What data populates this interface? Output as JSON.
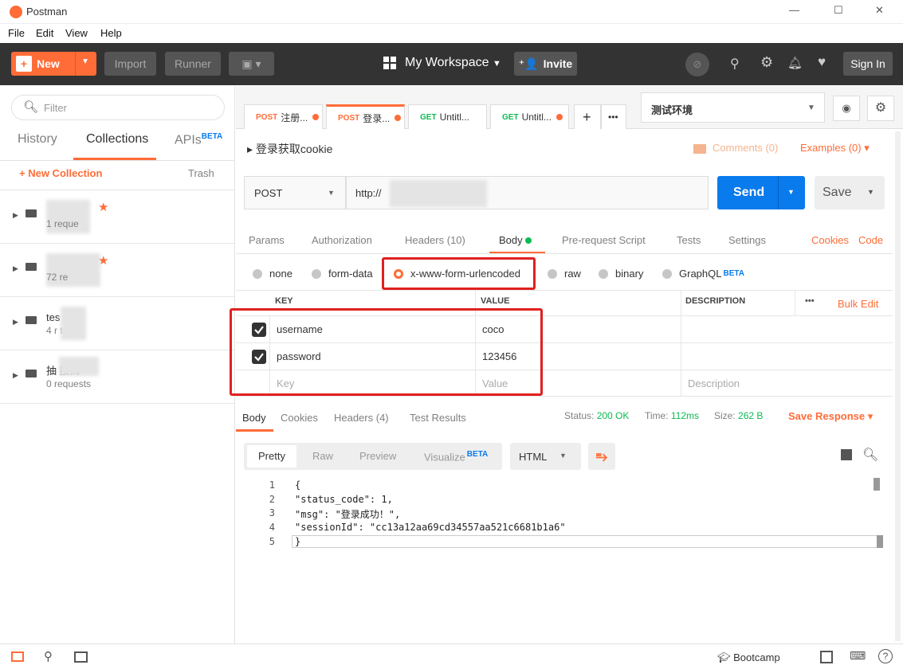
{
  "window": {
    "title": "Postman",
    "min": "—",
    "max": "☐",
    "close": "✕"
  },
  "menu": [
    "File",
    "Edit",
    "View",
    "Help"
  ],
  "header": {
    "new": "New",
    "import": "Import",
    "runner": "Runner",
    "workspace": "My Workspace",
    "invite": "Invite",
    "signin": "Sign In"
  },
  "sidebar": {
    "filter_placeholder": "Filter",
    "tabs": {
      "history": "History",
      "collections": "Collections",
      "apis": "APIs",
      "beta": "BETA"
    },
    "new_collection": "New Collection",
    "trash": "Trash",
    "collections": [
      {
        "name": "",
        "count": "1 reque"
      },
      {
        "name": "",
        "count": "72 re"
      },
      {
        "name": "tes       ▮口",
        "count": "4 r       ts"
      },
      {
        "name": "抽        接口",
        "count": "0 requests"
      }
    ]
  },
  "tabs": [
    {
      "method": "POST",
      "label": "注册..."
    },
    {
      "method": "POST",
      "label": "登录..."
    },
    {
      "method": "GET",
      "label": "Untitl..."
    },
    {
      "method": "GET",
      "label": "Untitl..."
    }
  ],
  "env": {
    "selected": "测试环境"
  },
  "request": {
    "title": "登录获取cookie",
    "comments": "Comments (0)",
    "examples": "Examples (0)",
    "method": "POST",
    "url": "http://                  0/api/login",
    "send": "Send",
    "save": "Save",
    "tabs": [
      "Params",
      "Authorization",
      "Headers (10)",
      "Body",
      "Pre-request Script",
      "Tests",
      "Settings"
    ],
    "cookies": "Cookies",
    "code": "Code",
    "body_types": [
      "none",
      "form-data",
      "x-www-form-urlencoded",
      "raw",
      "binary",
      "GraphQL"
    ],
    "graphql_beta": "BETA",
    "columns": {
      "key": "KEY",
      "value": "VALUE",
      "description": "DESCRIPTION",
      "more": "•••",
      "bulk": "Bulk Edit"
    },
    "rows": [
      {
        "key": "username",
        "value": "coco"
      },
      {
        "key": "password",
        "value": "123456"
      }
    ],
    "placeholder": {
      "key": "Key",
      "value": "Value",
      "description": "Description"
    }
  },
  "response": {
    "tabs": [
      "Body",
      "Cookies",
      "Headers (4)",
      "Test Results"
    ],
    "status_label": "Status:",
    "status": "200 OK",
    "time_label": "Time:",
    "time": "112ms",
    "size_label": "Size:",
    "size": "262 B",
    "save": "Save Response",
    "views": [
      "Pretty",
      "Raw",
      "Preview",
      "Visualize"
    ],
    "visualize_beta": "BETA",
    "format": "HTML",
    "lines": [
      "{",
      "\"status_code\": 1,",
      "\"msg\": \"登录成功！\",",
      "\"sessionId\": \"cc13a12aa69cd34557aa521c6681b1a6\"",
      "}"
    ]
  },
  "footer": {
    "bootcamp": "Bootcamp"
  },
  "colors": {
    "accent": "#ff6c37",
    "send": "#097bed",
    "status_ok": "#0cbb52",
    "highlight": "#e02020"
  }
}
